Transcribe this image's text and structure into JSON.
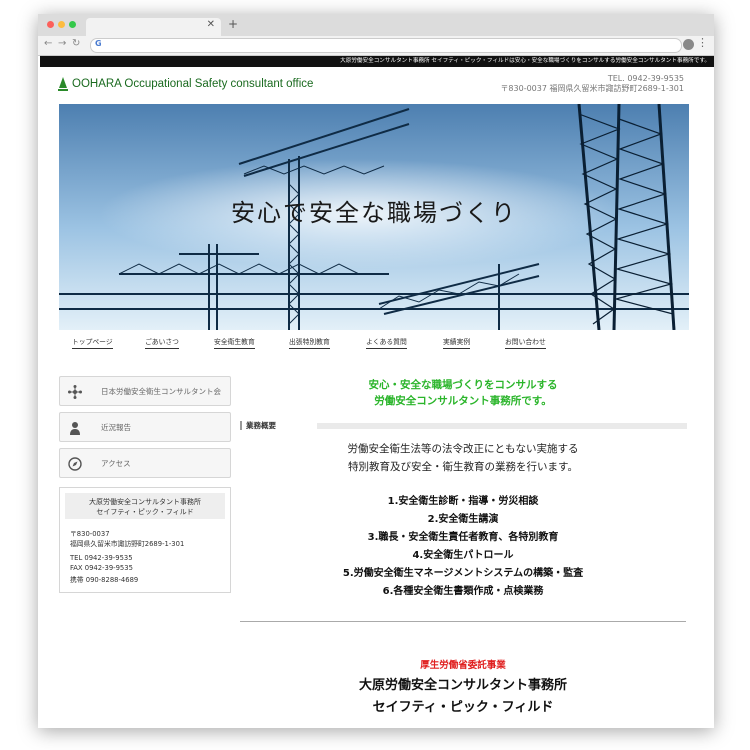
{
  "site": {
    "topbar_text": "大原労働安全コンサルタント事務所 セイフティ・ピック・フィルドは安心・安全な職場づくりをコンサルする労働安全コンサルタント事務所です。",
    "logo_text": "OOHARA Occupational Safety consultant office",
    "phone": "TEL. 0942-39-9535",
    "address": "〒830-0037 福岡県久留米市諏訪野町2689-1-301",
    "hero_title": "安心で安全な職場づくり"
  },
  "nav": [
    "トップページ",
    "ごあいさつ",
    "安全衛生教育",
    "出張特別教育",
    "よくある質問",
    "実績実例",
    "お問い合わせ"
  ],
  "sidebar": {
    "items": [
      {
        "label": "日本労働安全衛生コンサルタント会",
        "icon": "network-icon"
      },
      {
        "label": "近況報告",
        "icon": "person-icon"
      },
      {
        "label": "アクセス",
        "icon": "compass-icon"
      }
    ],
    "address_box": {
      "name_line1": "大原労働安全コンサルタント事務所",
      "name_line2": "セイフティ・ピック・フィルド",
      "zip": "〒830-0037",
      "addr": "福岡県久留米市諏訪野町2689-1-301",
      "tel": "TEL 0942-39-9535",
      "fax": "FAX 0942-39-9535",
      "mobile": "携帯 090-8288-4689"
    }
  },
  "main": {
    "lead_line1": "安心・安全な職場づくりをコンサルする",
    "lead_line2": "労働安全コンサルタント事務所です。",
    "section_title": "業務概要",
    "desc_line1": "労働安全衛生法等の法令改正にともない実施する",
    "desc_line2": "特別教育及び安全・衛生教育の業務を行います。",
    "services": [
      "1.安全衛生診断・指導・労災相談",
      "2.安全衛生講演",
      "3.職長・安全衛生責任者教育、各特別教育",
      "4.安全衛生パトロール",
      "5.労働安全衛生マネージメントシステムの構築・監査",
      "6.各種安全衛生書類作成・点検業務"
    ],
    "ministry_label": "厚生労働省委託事業",
    "office_name": "大原労働安全コンサルタント事務所",
    "office_subname": "セイフティ・ピック・フィルド"
  },
  "colors": {
    "accent_green": "#2bb52b",
    "logo_green": "#1a6a1f",
    "ministry_red": "#e02020",
    "topbar": "#111111"
  }
}
